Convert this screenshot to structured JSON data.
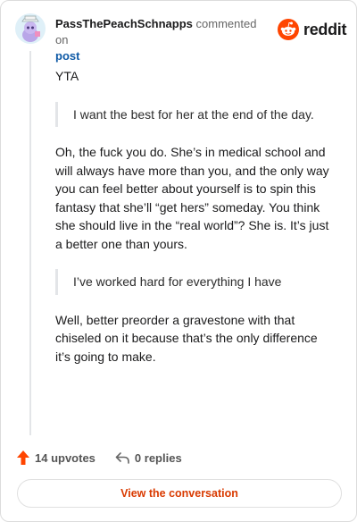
{
  "header": {
    "username": "PassThePeachSchnapps",
    "action_text": "commented on",
    "post_link": "post",
    "logo_text": "reddit"
  },
  "comment": {
    "paragraphs": [
      {
        "type": "text",
        "text": "YTA"
      },
      {
        "type": "quote",
        "text": "I want the best for her at the end of the day."
      },
      {
        "type": "text",
        "text": "Oh, the fuck you do. She’s in medical school and will always have more than you, and the only way you can feel better about yourself is to spin this fantasy that she’ll “get hers” someday. You think she should live in the “real world”? She is. It’s just a better one than yours."
      },
      {
        "type": "quote",
        "text": "I’ve worked hard for everything I have"
      },
      {
        "type": "text",
        "text": "Well, better preorder a gravestone with that chiseled on it because that’s the only difference it’s going to make."
      }
    ]
  },
  "footer": {
    "upvotes_label": "14 upvotes",
    "replies_label": "0 replies"
  },
  "button": {
    "view_conversation": "View the conversation"
  },
  "icons": {
    "upvote": "upvote-arrow-icon",
    "reply": "reply-icon",
    "logo": "reddit-logo-icon"
  },
  "colors": {
    "accent": "#d93a00",
    "upvote": "#ff4500",
    "link": "#0f5aa6"
  }
}
